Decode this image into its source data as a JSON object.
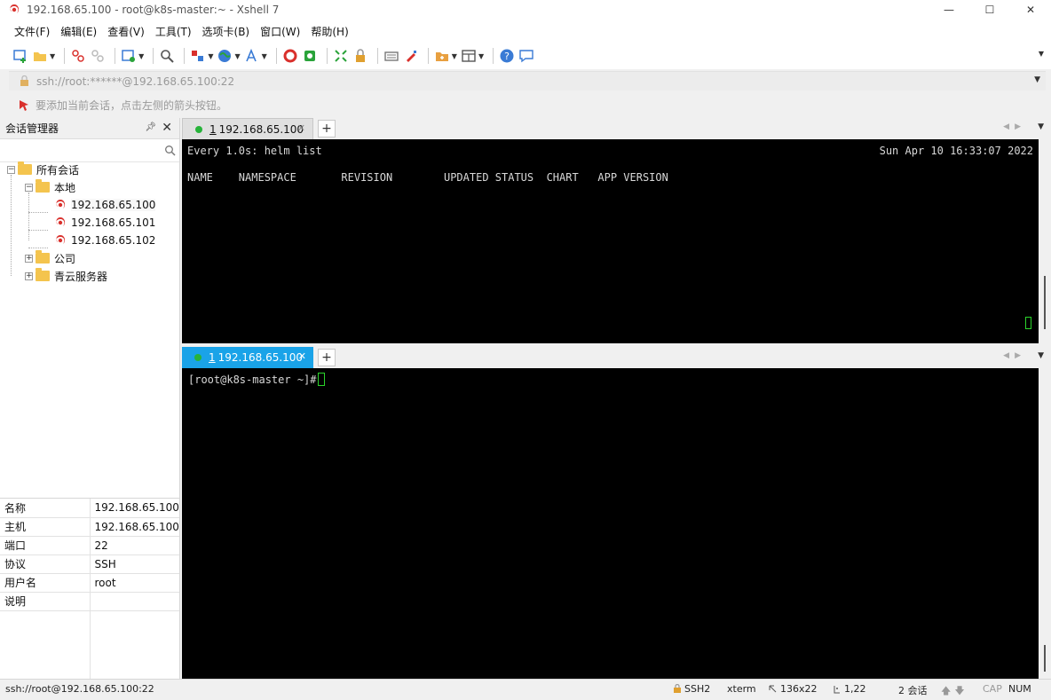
{
  "window": {
    "title": "192.168.65.100 - root@k8s-master:~ - Xshell 7",
    "minimize_glyph": "—",
    "maximize_glyph": "☐",
    "close_glyph": "✕"
  },
  "menu": [
    "文件(F)",
    "编辑(E)",
    "查看(V)",
    "工具(T)",
    "选项卡(B)",
    "窗口(W)",
    "帮助(H)"
  ],
  "address_bar": {
    "value": "ssh://root:******@192.168.65.100:22"
  },
  "hint_bar": {
    "text": "要添加当前会话，点击左侧的箭头按钮。"
  },
  "session_manager": {
    "title": "会话管理器",
    "tree": {
      "root": "所有会话",
      "local": "本地",
      "sessions": [
        "192.168.65.100",
        "192.168.65.101",
        "192.168.65.102"
      ],
      "company": "公司",
      "cloud": "青云服务器"
    },
    "properties": [
      {
        "key": "名称",
        "value": "192.168.65.100"
      },
      {
        "key": "主机",
        "value": "192.168.65.100"
      },
      {
        "key": "端口",
        "value": "22"
      },
      {
        "key": "协议",
        "value": "SSH"
      },
      {
        "key": "用户名",
        "value": "root"
      },
      {
        "key": "说明",
        "value": ""
      }
    ]
  },
  "top_pane": {
    "tab": {
      "number": "1",
      "label": "192.168.65.100"
    },
    "lines": [
      {
        "left": "Every 1.0s: helm list",
        "right": "Sun Apr 10 16:33:07 2022"
      },
      {
        "left": "NAME    NAMESPACE       REVISION        UPDATED STATUS  CHART   APP VERSION"
      }
    ]
  },
  "bottom_pane": {
    "tab": {
      "number": "1",
      "label": "192.168.65.100"
    },
    "prompt": "[root@k8s-master ~]# "
  },
  "status_bar": {
    "connection": "ssh://root@192.168.65.100:22",
    "protocol": "SSH2",
    "terminal": "xterm",
    "size": "136x22",
    "cursor": "1,22",
    "sessions": "2 会话",
    "caps": "CAP",
    "num": "NUM"
  },
  "colors": {
    "accent_tab": "#1aa3e8",
    "terminal_bg": "#000000",
    "terminal_fg": "#d8d8d8",
    "cursor": "#2bd42b",
    "session_icon": "#d9302c",
    "folder": "#f4c44e"
  }
}
